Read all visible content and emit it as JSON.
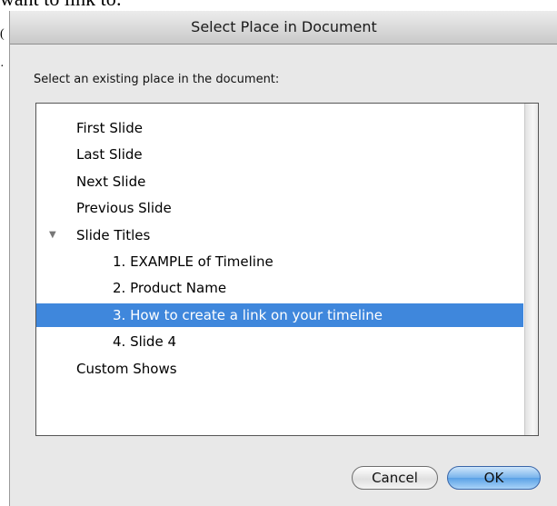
{
  "background": {
    "partial_text": "want to link to:"
  },
  "dialog": {
    "title": "Select Place in Document",
    "prompt": "Select an existing place in the document:",
    "places": [
      {
        "label": "First Slide",
        "level": 0,
        "selected": false
      },
      {
        "label": "Last Slide",
        "level": 0,
        "selected": false
      },
      {
        "label": "Next Slide",
        "level": 0,
        "selected": false
      },
      {
        "label": "Previous Slide",
        "level": 0,
        "selected": false
      },
      {
        "label": "Slide Titles",
        "level": 0,
        "selected": false,
        "expanded": true,
        "icon": "disclosure-triangle-down-icon"
      },
      {
        "label": "1. EXAMPLE of Timeline",
        "level": 1,
        "selected": false
      },
      {
        "label": "2. Product Name",
        "level": 1,
        "selected": false
      },
      {
        "label": "3. How to create a link on your timeline",
        "level": 1,
        "selected": true
      },
      {
        "label": "4. Slide 4",
        "level": 1,
        "selected": false
      },
      {
        "label": "Custom Shows",
        "level": 0,
        "selected": false
      }
    ],
    "buttons": {
      "cancel_label": "Cancel",
      "ok_label": "OK"
    },
    "colors": {
      "selection": "#3f87dc",
      "default_button": "#79b4ec"
    }
  }
}
